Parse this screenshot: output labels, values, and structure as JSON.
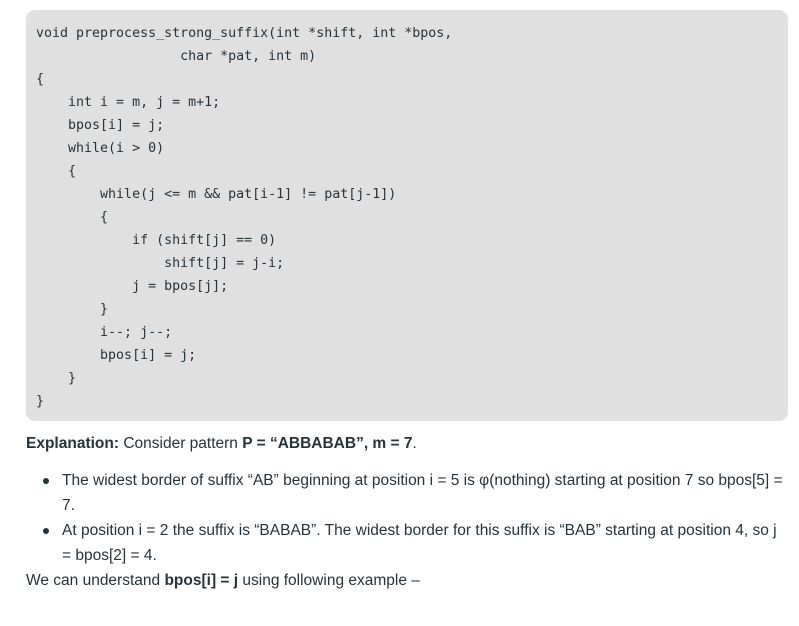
{
  "code": {
    "lines": [
      "void preprocess_strong_suffix(int *shift, int *bpos,",
      "                  char *pat, int m)",
      "{",
      "    int i = m, j = m+1;",
      "    bpos[i] = j;",
      "    while(i > 0)",
      "    {",
      "        while(j <= m && pat[i-1] != pat[j-1])",
      "        {",
      "            if (shift[j] == 0)",
      "                shift[j] = j-i;",
      "            j = bpos[j];",
      "        }",
      "        i--; j--;",
      "        bpos[i] = j;",
      "    }",
      "}"
    ]
  },
  "explanation": {
    "label": "Explanation:",
    "text_before": " Consider pattern ",
    "pattern": "P = “ABBABAB”, m = 7",
    "text_after": "."
  },
  "bullets": [
    "The widest border of suffix “AB” beginning at position i = 5 is φ(nothing) starting at position 7 so bpos[5] = 7.",
    "At position i = 2 the suffix is “BABAB”. The widest border for this suffix is “BAB” starting at position 4, so j = bpos[2] = 4."
  ],
  "closing": {
    "text_before": "We can understand ",
    "emphasis": "bpos[i] = j",
    "text_after": " using following example –"
  }
}
